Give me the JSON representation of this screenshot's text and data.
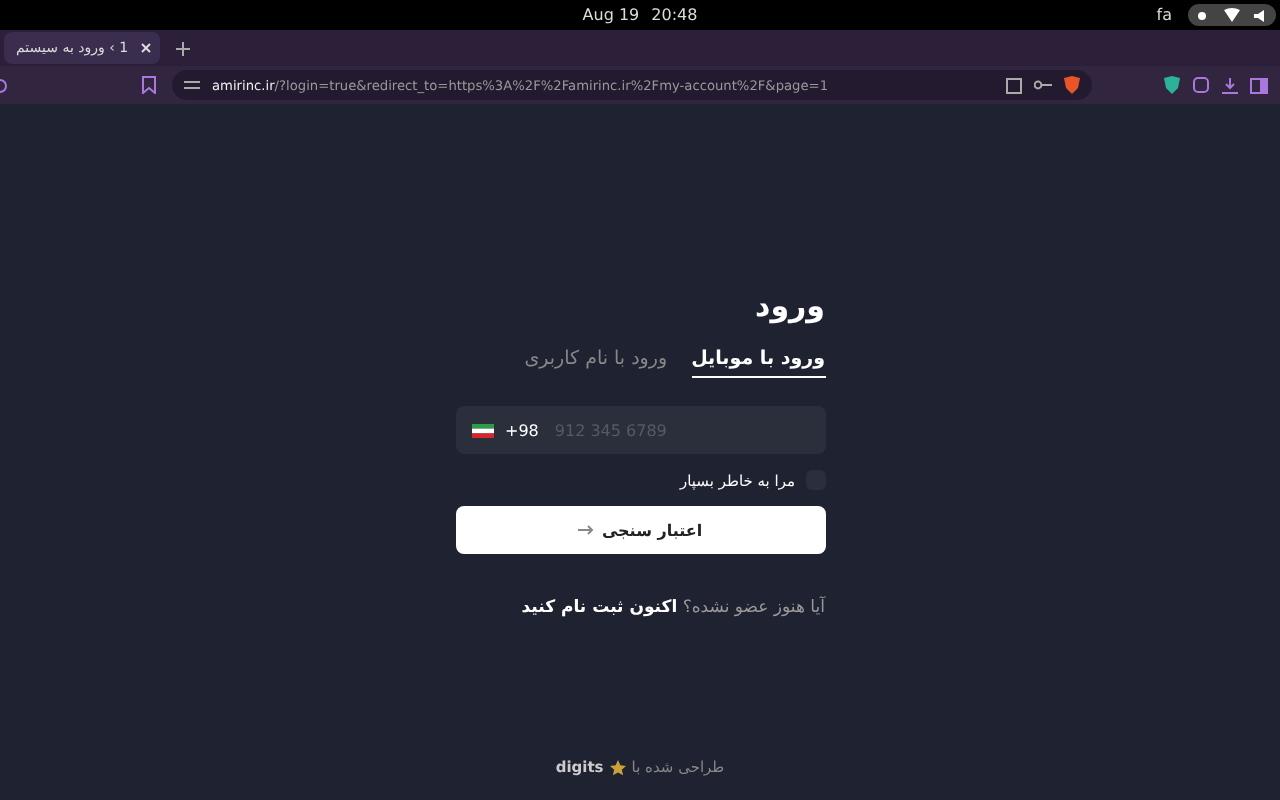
{
  "system_bar": {
    "date": "Aug 19",
    "time": "20:48",
    "language": "fa"
  },
  "browser": {
    "tab_title": "1 › ورود به سیستم",
    "url_domain": "amirinc.ir",
    "url_path": "/?login=true&redirect_to=https%3A%2F%2Famirinc.ir%2Fmy-account%2F&page=1"
  },
  "login": {
    "title": "ورود",
    "tabs": [
      {
        "label": "ورود با موبایل",
        "selected": true
      },
      {
        "label": "ورود با نام کاربری",
        "selected": false
      }
    ],
    "phone": {
      "country_code": "+98",
      "placeholder": "912 345 6789"
    },
    "remember": {
      "label": "مرا به خاطر بسپار",
      "checked": false
    },
    "submit": "اعتبار سنجی",
    "register_prompt": "آیا هنوز عضو نشده؟",
    "register_link": "اکنون ثبت نام کنید"
  },
  "footer": {
    "text": "طراحی شده با",
    "brand": "digits"
  }
}
